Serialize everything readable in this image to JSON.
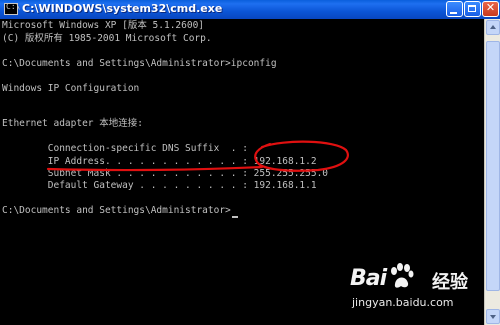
{
  "window": {
    "title": "C:\\WINDOWS\\system32\\cmd.exe",
    "icon": "cmd-icon",
    "buttons": {
      "minimize": "minimize-icon",
      "maximize": "maximize-icon",
      "close_glyph": "✕"
    }
  },
  "console": {
    "lines": [
      "Microsoft Windows XP [版本 5.1.2600]",
      "(C) 版权所有 1985-2001 Microsoft Corp.",
      "",
      "C:\\Documents and Settings\\Administrator>ipconfig",
      "",
      "Windows IP Configuration",
      "",
      "",
      "Ethernet adapter 本地连接:",
      "",
      "        Connection-specific DNS Suffix  . :",
      "        IP Address. . . . . . . . . . . . : 192.168.1.2",
      "        Subnet Mask . . . . . . . . . . . : 255.255.255.0",
      "        Default Gateway . . . . . . . . . : 192.168.1.1",
      "",
      "C:\\Documents and Settings\\Administrator>"
    ]
  },
  "watermark": {
    "logo": "Bai",
    "logo_suffix": "经验",
    "url": "jingyan.baidu.com"
  },
  "colors": {
    "console_bg": "#000000",
    "console_text": "#c0c0c0",
    "titlebar": "#0a5fdc",
    "annotation": "#e01010"
  }
}
